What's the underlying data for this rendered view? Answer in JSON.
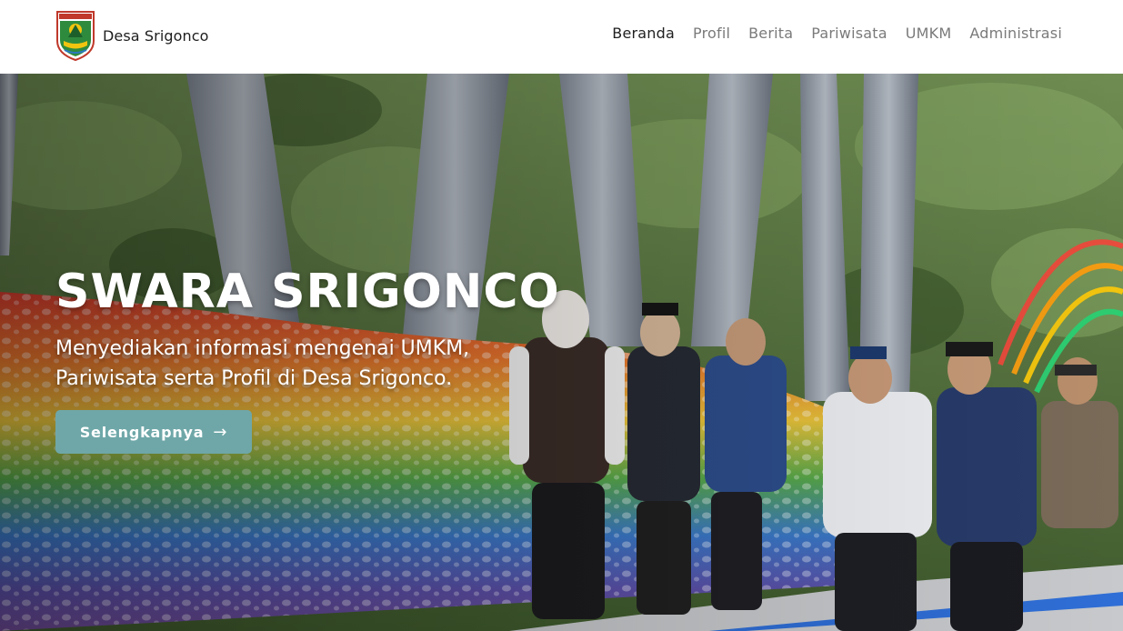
{
  "brand": {
    "name": "Desa Srigonco",
    "logo_icon": "kabupaten-malang-crest-icon"
  },
  "nav": {
    "items": [
      {
        "label": "Beranda",
        "active": true
      },
      {
        "label": "Profil",
        "active": false
      },
      {
        "label": "Berita",
        "active": false
      },
      {
        "label": "Pariwisata",
        "active": false
      },
      {
        "label": "UMKM",
        "active": false
      },
      {
        "label": "Administrasi",
        "active": false
      }
    ]
  },
  "hero": {
    "title": "SWARA SRIGONCO",
    "subtitle_line1": "Menyediakan informasi mengenai UMKM,",
    "subtitle_line2": "Pariwisata serta Profil di Desa Srigonco.",
    "cta_label": "Selengkapnya",
    "cta_icon": "arrow-right-icon"
  },
  "colors": {
    "cta": "#6fa7a8",
    "nav_active": "#1f1f1f",
    "nav_inactive": "#7a7a7a"
  }
}
